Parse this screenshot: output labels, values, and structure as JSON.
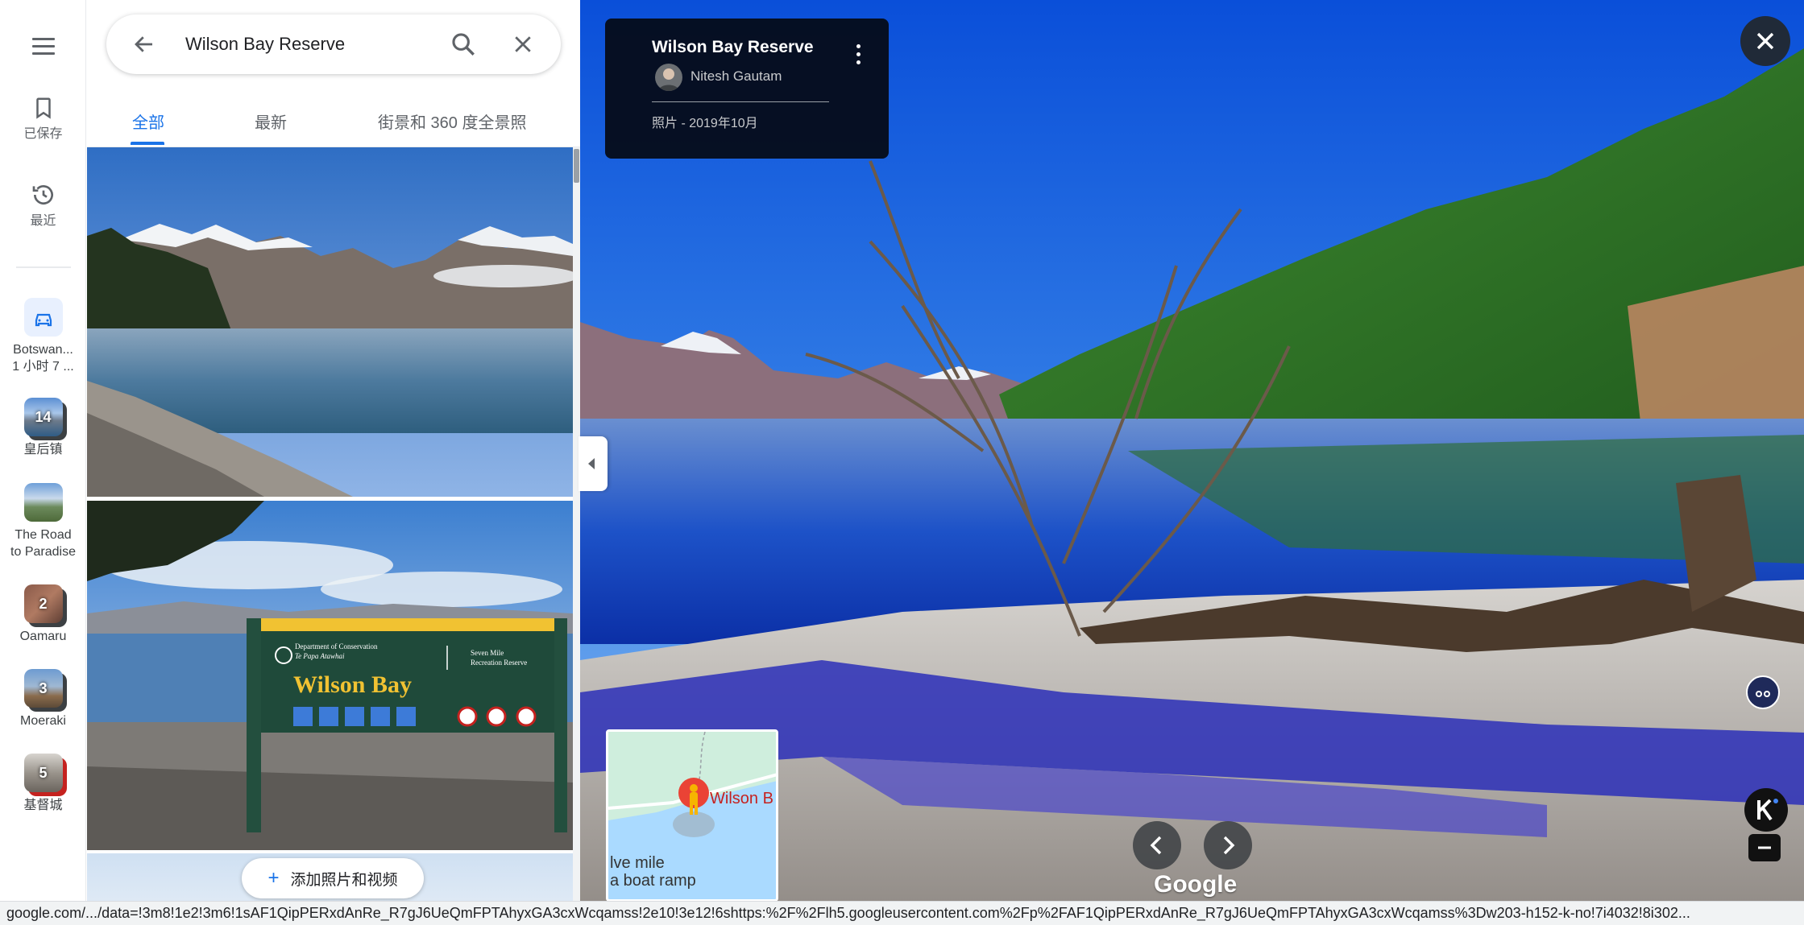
{
  "rail": {
    "items": [
      {
        "label": "已保存",
        "icon": "bookmark-icon"
      },
      {
        "label": "最近",
        "icon": "history-icon"
      }
    ],
    "recents": [
      {
        "line1": "Botswan...",
        "line2": "1 小时 7 ...",
        "icon": "car-icon"
      },
      {
        "label": "皇后镇",
        "count": "14"
      },
      {
        "label1": "The Road",
        "label2": "to Paradise"
      },
      {
        "label": "Oamaru",
        "count": "2"
      },
      {
        "label": "Moeraki",
        "count": "3"
      },
      {
        "label": "基督城",
        "count": "5"
      }
    ]
  },
  "search": {
    "value": "Wilson Bay Reserve"
  },
  "tabs": [
    {
      "label": "全部",
      "active": true
    },
    {
      "label": "最新",
      "active": false
    },
    {
      "label": "街景和 360 度全景照",
      "active": false
    }
  ],
  "photos": {
    "sign": {
      "dept_line1": "Department of Conservation",
      "dept_line2": "Te Papa Atawhai",
      "name": "Wilson Bay",
      "side_line1": "Seven Mile",
      "side_line2": "Recreation Reserve"
    }
  },
  "add_button": {
    "label": "添加照片和视频"
  },
  "viewer": {
    "title": "Wilson Bay Reserve",
    "author": "Nitesh Gautam",
    "date": "照片 - 2019年10月",
    "minimap": {
      "place": "Wilson B",
      "line1": "lve mile",
      "line2": "a boat ramp"
    },
    "logo": "Google"
  },
  "status_url": "google.com/.../data=!3m8!1e2!3m6!1sAF1QipPERxdAnRe_R7gJ6UeQmFPTAhyxGA3cxWcqamss!2e10!3e12!6shttps:%2F%2Flh5.googleusercontent.com%2Fp%2FAF1QipPERxdAnRe_R7gJ6UeQmFPTAhyxGA3cxWcqamss%3Dw203-h152-k-no!7i4032!8i302...",
  "colors": {
    "accent": "#1a73e8",
    "card_bg": "#050a14",
    "pin": "#ea4335"
  }
}
